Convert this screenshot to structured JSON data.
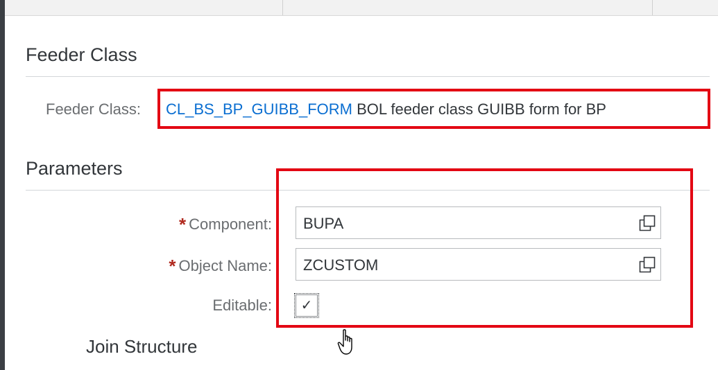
{
  "feeder_section": {
    "title": "Feeder Class",
    "label": "Feeder Class:",
    "class_name": "CL_BS_BP_GUIBB_FORM",
    "class_description": "BOL feeder class GUIBB form for BP"
  },
  "parameters_section": {
    "title": "Parameters",
    "component": {
      "required_mark": "*",
      "label": "Component:",
      "value": "BUPA",
      "value_help_icon": "value-help-icon"
    },
    "object_name": {
      "required_mark": "*",
      "label": "Object Name:",
      "value": "ZCUSTOM",
      "value_help_icon": "value-help-icon"
    },
    "editable": {
      "label": "Editable:",
      "checked": true,
      "check_glyph": "✓"
    }
  },
  "join_structure": {
    "title": "Join Structure"
  },
  "colors": {
    "highlight": "#e30613",
    "link": "#0a6ed1",
    "required": "#b0291e"
  }
}
